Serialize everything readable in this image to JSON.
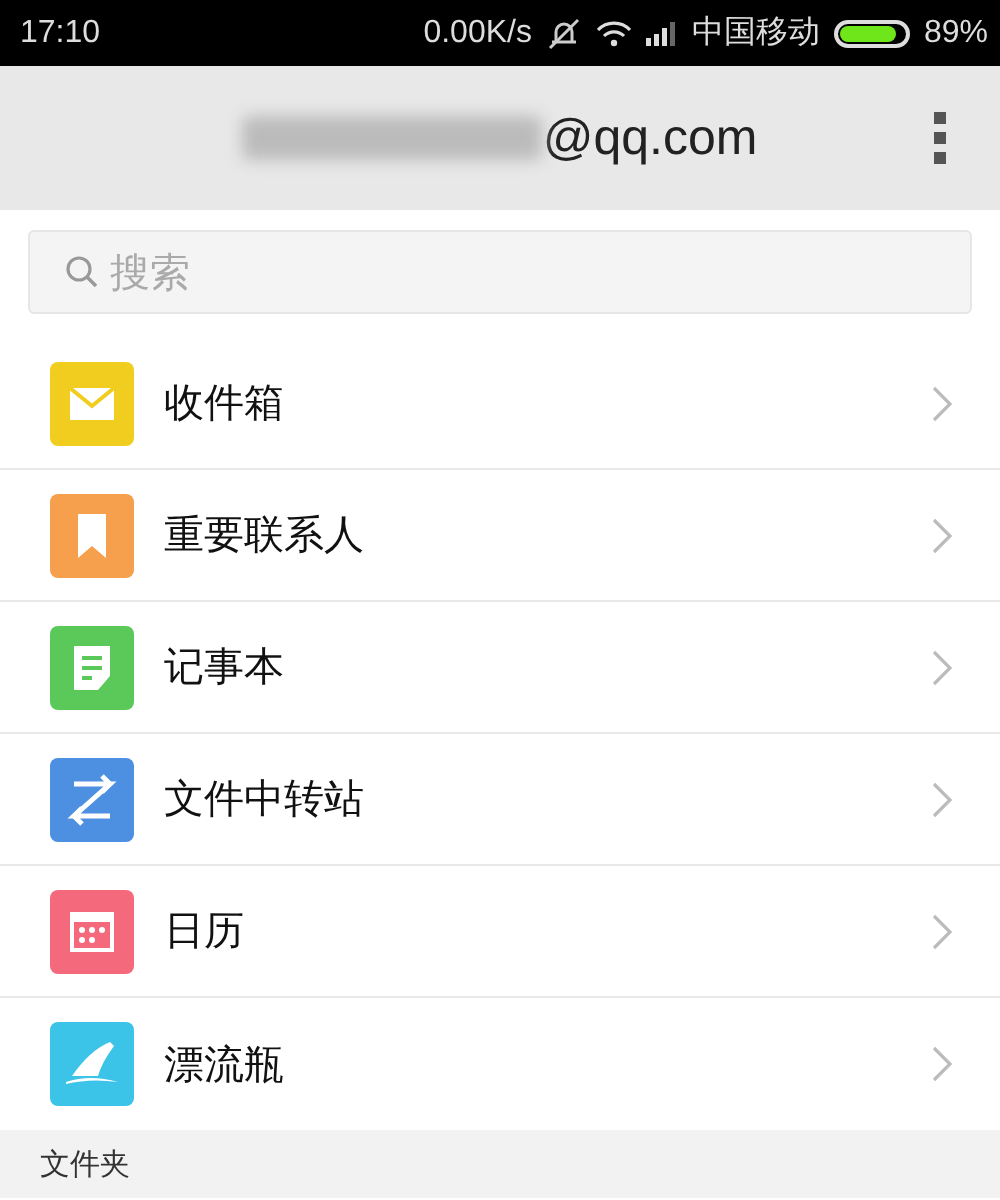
{
  "status_bar": {
    "time": "17:10",
    "speed": "0.00K/s",
    "carrier": "中国移动",
    "battery": {
      "level": 0.89
    },
    "battery_text": "89%"
  },
  "header": {
    "account_suffix": "@qq.com"
  },
  "search": {
    "placeholder": "搜索"
  },
  "items": [
    {
      "label": "收件箱",
      "kind": "mail",
      "color": "#f1cd1f"
    },
    {
      "label": "重要联系人",
      "kind": "bookmark",
      "color": "#f6a04d"
    },
    {
      "label": "记事本",
      "kind": "note",
      "color": "#5bc85a"
    },
    {
      "label": "文件中转站",
      "kind": "transfer",
      "color": "#4d8fe0"
    },
    {
      "label": "日历",
      "kind": "calendar",
      "color": "#f46a7c"
    },
    {
      "label": "漂流瓶",
      "kind": "bottle",
      "color": "#3cc3e8"
    }
  ],
  "section": {
    "title": "文件夹"
  }
}
